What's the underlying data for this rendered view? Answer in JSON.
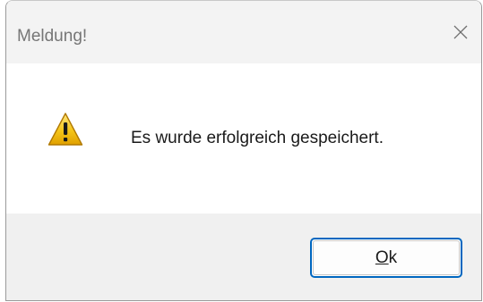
{
  "dialog": {
    "title": "Meldung!",
    "message": "Es wurde erfolgreich gespeichert.",
    "icon": "warning-icon",
    "close_icon": "close-icon"
  },
  "buttons": {
    "ok": {
      "mnemonic": "O",
      "rest": "k"
    }
  },
  "colors": {
    "accent": "#0067c0",
    "titlebar": "#f3f3f3",
    "footer": "#f0f0f0",
    "warning_fill": "#f5c518"
  }
}
